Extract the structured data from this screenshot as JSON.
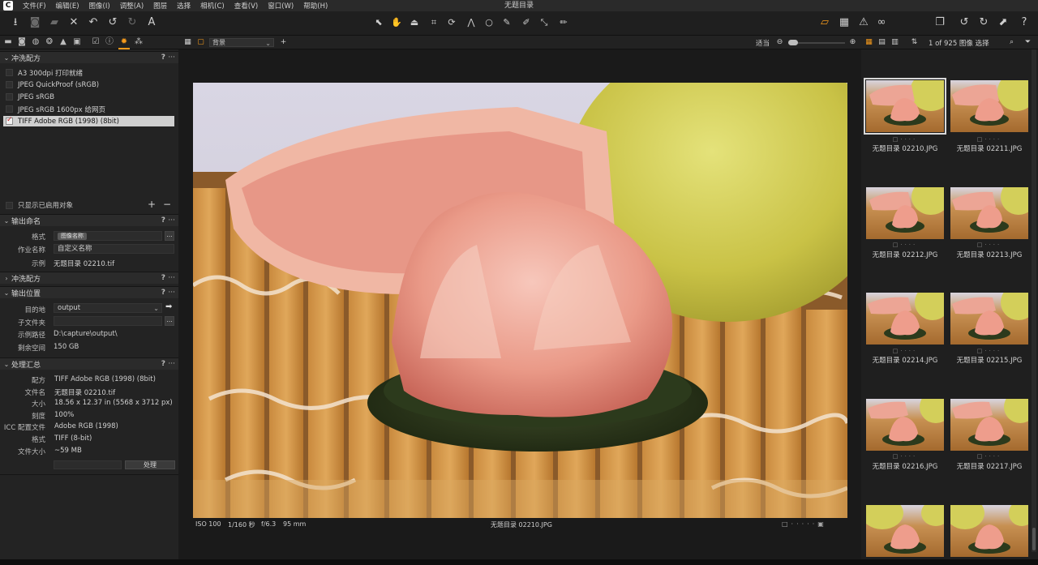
{
  "window": {
    "title": "无题目录",
    "app_icon": "C"
  },
  "menu": [
    "文件(F)",
    "编辑(E)",
    "图像(I)",
    "调整(A)",
    "图层",
    "选择",
    "相机(C)",
    "查看(V)",
    "窗口(W)",
    "帮助(H)"
  ],
  "left_tabs": {
    "active": "process-tab-icon"
  },
  "process_recipes": {
    "title": "冲洗配方",
    "items": [
      {
        "label": "A3 300dpi 打印就绪",
        "checked": false
      },
      {
        "label": "JPEG QuickProof (sRGB)",
        "checked": false
      },
      {
        "label": "JPEG sRGB",
        "checked": false
      },
      {
        "label": "JPEG sRGB 1600px 给网页",
        "checked": false
      },
      {
        "label": "TIFF Adobe RGB (1998) (8bit)",
        "checked": true
      }
    ],
    "show_enabled_label": "只显示已启用对象"
  },
  "output_naming": {
    "title": "输出命名",
    "format_label": "格式",
    "format_chip": "图像名称",
    "job_name_label": "作业名称",
    "job_name_value": "自定义名称",
    "sample_label": "示例",
    "sample_value": "无题目录 02210.tif"
  },
  "process_recipe_collapsed": {
    "title": "冲洗配方"
  },
  "output_location": {
    "title": "输出位置",
    "destination_label": "目的地",
    "destination_value": "output",
    "subfolder_label": "子文件夹",
    "subfolder_value": "",
    "sample_path_label": "示例路径",
    "sample_path_value": "D:\\capture\\output\\",
    "free_space_label": "剩余空间",
    "free_space_value": "150 GB"
  },
  "process_summary": {
    "title": "处理汇总",
    "rows": [
      {
        "label": "配方",
        "value": "TIFF Adobe RGB (1998) (8bit)"
      },
      {
        "label": "文件名",
        "value": "无题目录 02210.tif"
      },
      {
        "label": "大小",
        "value": "18.56 x 12.37 in (5568 x 3712 px)"
      },
      {
        "label": "刻度",
        "value": "100%"
      },
      {
        "label": "ICC 配置文件",
        "value": "Adobe RGB (1998)"
      },
      {
        "label": "格式",
        "value": "TIFF (8-bit)"
      },
      {
        "label": "文件大小",
        "value": "~59 MB"
      }
    ],
    "process_button": "处理"
  },
  "viewer": {
    "background_select": "背景",
    "fit_label": "适当",
    "iso": "ISO 100",
    "shutter": "1/160 秒",
    "aperture": "f/6.3",
    "focal": "95 mm",
    "filename": "无题目录 02210.JPG"
  },
  "browser": {
    "count": "1 of 925 图像 选择",
    "thumbnails": [
      {
        "name": "无题目录 02210.JPG",
        "selected": true
      },
      {
        "name": "无题目录 02211.JPG",
        "selected": false
      },
      {
        "name": "无题目录 02212.JPG",
        "selected": false
      },
      {
        "name": "无题目录 02213.JPG",
        "selected": false
      },
      {
        "name": "无题目录 02214.JPG",
        "selected": false
      },
      {
        "name": "无题目录 02215.JPG",
        "selected": false
      },
      {
        "name": "无题目录 02216.JPG",
        "selected": false
      },
      {
        "name": "无题目录 02217.JPG",
        "selected": false
      },
      {
        "name": "",
        "selected": false
      },
      {
        "name": "",
        "selected": false
      }
    ]
  },
  "colors": {
    "accent": "#f59a1c",
    "panel": "#232323",
    "viewer": "#1a1a1a"
  }
}
